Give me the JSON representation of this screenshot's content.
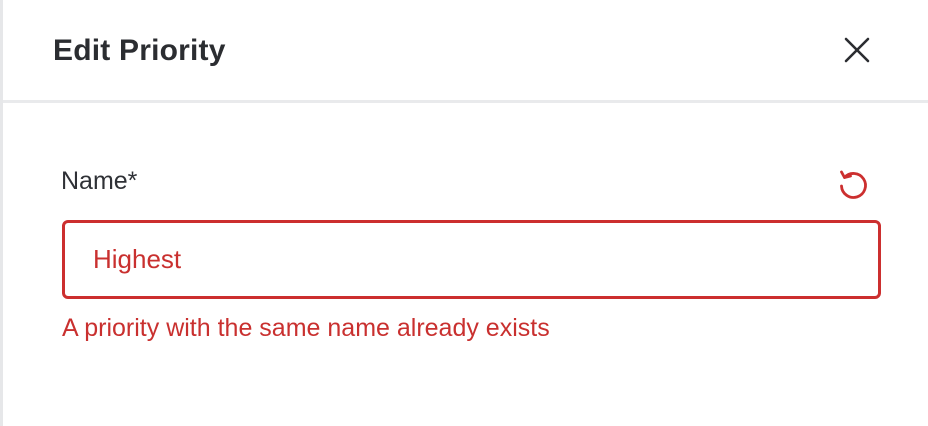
{
  "dialog": {
    "title": "Edit Priority",
    "close_icon": "close-icon"
  },
  "form": {
    "name_field": {
      "label": "Name*",
      "value": "Highest",
      "reset_icon": "reset-icon",
      "error": "A priority with the same name already exists",
      "error_color": "#c9302f"
    }
  }
}
